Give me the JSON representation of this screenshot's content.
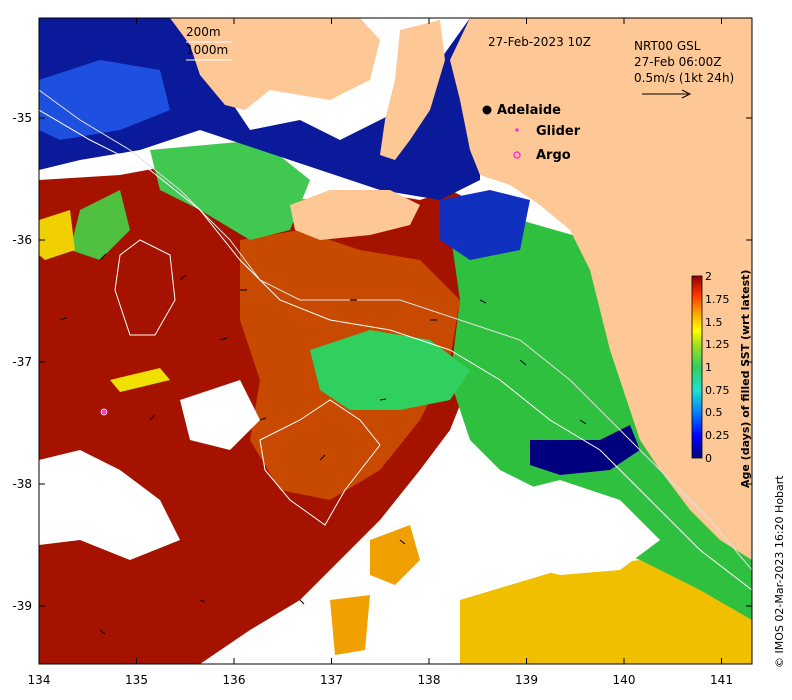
{
  "map": {
    "date_title": "27-Feb-2023 10Z",
    "contours": [
      "200m",
      "1000m"
    ],
    "current_info": {
      "line1": "NRT00 GSL",
      "line2": "27-Feb 06:00Z",
      "line3": "0.5m/s (1kt 24h)"
    },
    "places": [
      {
        "name": "Adelaide",
        "lon": 138.6,
        "lat": -34.93,
        "marker": "black-dot"
      }
    ],
    "legend": [
      {
        "label": "Glider",
        "marker": "magenta-dot",
        "color": "#ff33cc"
      },
      {
        "label": "Argo",
        "marker": "magenta-ring",
        "color": "#ff33cc"
      }
    ],
    "glider_position": {
      "lon": 134.7,
      "lat": -37.42
    },
    "x_axis": {
      "range": [
        134,
        141.3
      ],
      "ticks": [
        "134",
        "135",
        "136",
        "137",
        "138",
        "139",
        "140",
        "141"
      ]
    },
    "y_axis": {
      "range": [
        -39.5,
        -34.2
      ],
      "ticks": [
        "-35",
        "-36",
        "-37",
        "-38",
        "-39"
      ]
    },
    "colorbar": {
      "title": "Age (days) of filled SST (wrt latest)",
      "range": [
        0,
        2
      ],
      "ticks": [
        "0",
        "0.25",
        "0.5",
        "0.75",
        "1",
        "1.25",
        "1.5",
        "1.75",
        "2"
      ],
      "colors": [
        "#00007f",
        "#0000ff",
        "#00a0ff",
        "#20e0d0",
        "#30d060",
        "#80e020",
        "#ffff00",
        "#ffa000",
        "#ff3000",
        "#8f0000"
      ]
    },
    "credit": "© IMOS 02-Mar-2023 16:20 Hobart"
  }
}
